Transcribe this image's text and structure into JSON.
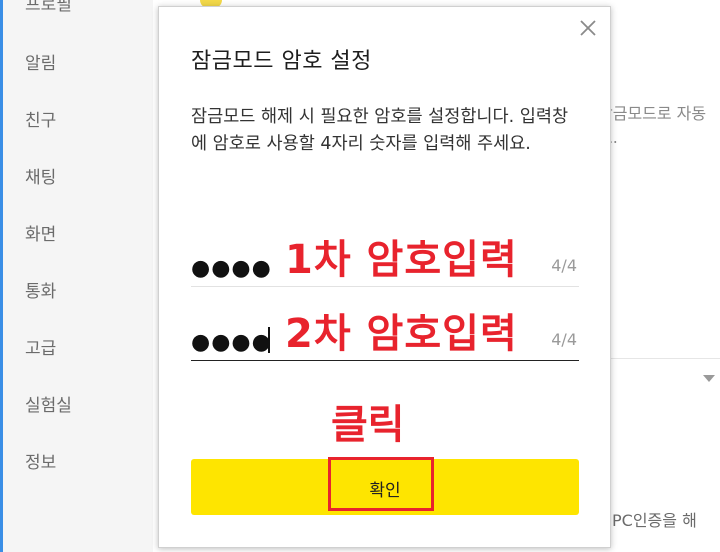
{
  "sidebar": {
    "items": [
      {
        "label": "프로필"
      },
      {
        "label": "알림"
      },
      {
        "label": "친구"
      },
      {
        "label": "채팅"
      },
      {
        "label": "화면"
      },
      {
        "label": "통화"
      },
      {
        "label": "고급"
      },
      {
        "label": "실험실"
      },
      {
        "label": "정보"
      }
    ]
  },
  "background": {
    "lock_desc_1": "잠금모드로 자동",
    "lock_desc_2": "요.",
    "pc_auth": "PC인증을 해"
  },
  "dialog": {
    "title": "잠금모드 암호 설정",
    "description": "잠금모드 해제 시 필요한 암호를 설정합니다. 입력창에 암호로 사용할 4자리 숫자를 입력해 주세요.",
    "fields": [
      {
        "masked_value": "●●●●",
        "counter": "4/4",
        "annotation": "1차 암호입력"
      },
      {
        "masked_value": "●●●●",
        "counter": "4/4",
        "annotation": "2차 암호입력"
      }
    ],
    "click_annotation": "클릭",
    "confirm_label": "확인"
  },
  "colors": {
    "accent_yellow": "#fee500",
    "annotation_red": "#e8232d",
    "sidebar_bg": "#f5f5f5"
  }
}
